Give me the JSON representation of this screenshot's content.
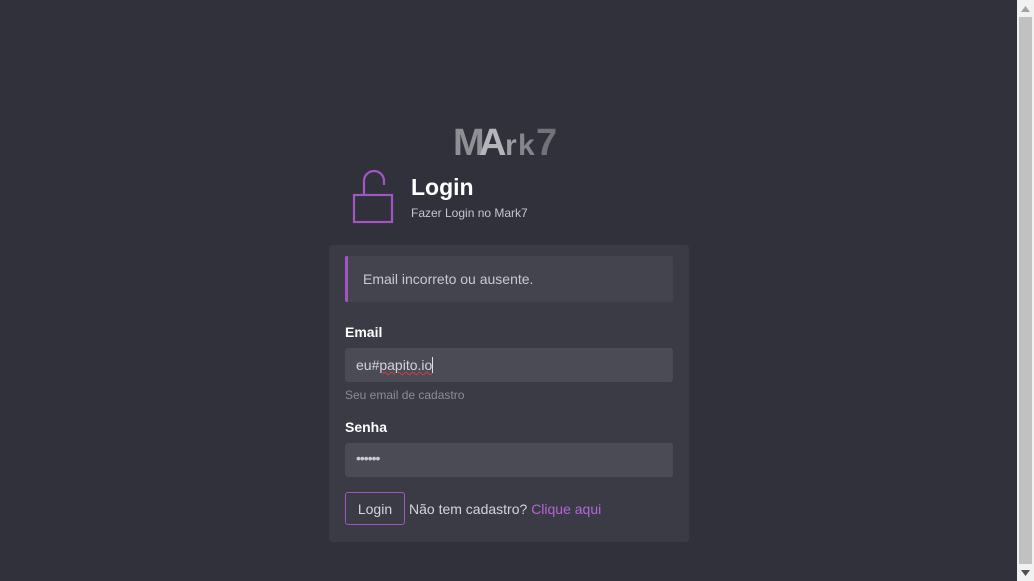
{
  "brand": {
    "logo_text": "MArk7",
    "accent_color": "#a256c4"
  },
  "header": {
    "icon": "unlock-icon",
    "title": "Login",
    "subtitle": "Fazer Login no Mark7"
  },
  "alert": {
    "message": "Email incorreto ou ausente."
  },
  "form": {
    "email": {
      "label": "Email",
      "value_prefix": "eu#",
      "value_underlined": "papito.io",
      "help": "Seu email de cadastro"
    },
    "password": {
      "label": "Senha",
      "masked_value": "••••••"
    },
    "submit_label": "Login",
    "signup_prompt": "Não tem cadastro?",
    "signup_link": "Clique aqui"
  }
}
